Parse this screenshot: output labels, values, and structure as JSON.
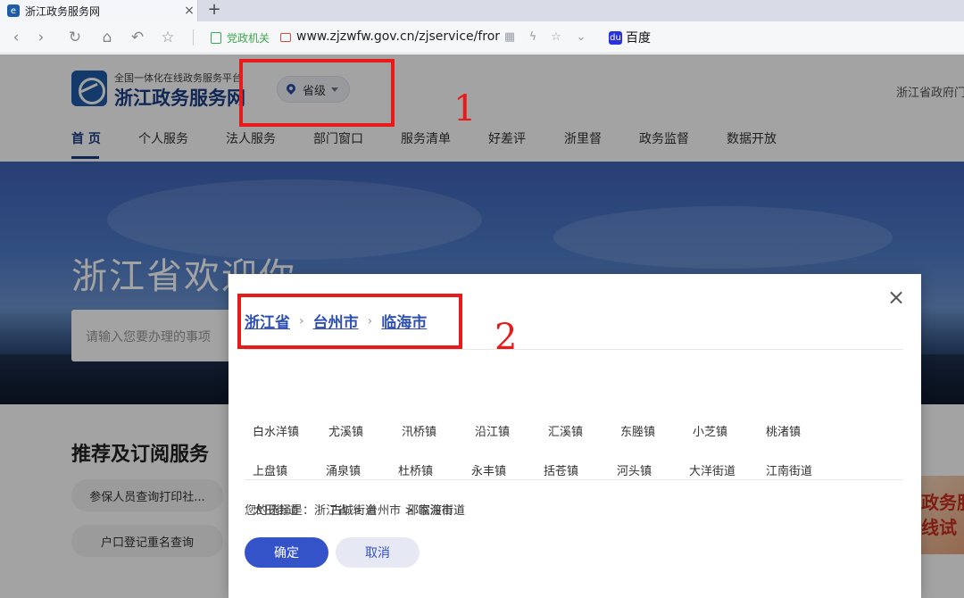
{
  "browser": {
    "tab_title": "浙江政务服务网",
    "tab_close": "×",
    "new_tab": "+",
    "security_label": "党政机关",
    "url": "www.zjzwfw.gov.cn/zjservice/fror",
    "search_engine": "百度",
    "icons": [
      "back-icon",
      "forward-icon",
      "refresh-icon",
      "home-icon",
      "undo-icon",
      "favorite-icon",
      "qr-icon",
      "bolt-icon",
      "star-icon",
      "dropdown-icon"
    ]
  },
  "header": {
    "logo_small": "全国一体化在线政务服务平台",
    "logo_big": "浙江政务服务网",
    "region": "省级",
    "right_text": "浙江省政府门"
  },
  "annotations": {
    "one": "1",
    "two": "2",
    "color": "#e81a1a"
  },
  "nav": {
    "items": [
      "首 页",
      "个人服务",
      "法人服务",
      "部门窗口",
      "服务清单",
      "好差评",
      "浙里督",
      "政务监督",
      "数据开放"
    ]
  },
  "hero": {
    "title": "浙江省欢迎你",
    "search_placeholder": "请输入您要办理的事项"
  },
  "section": {
    "title": "推荐及订阅服务",
    "services": [
      "参保人员查询打印社...",
      "户口登记重名查询"
    ]
  },
  "side_banner": {
    "line1": "政务服",
    "line2": "线试"
  },
  "modal": {
    "close": "×",
    "breadcrumb": [
      "浙江省",
      "台州市",
      "临海市"
    ],
    "separator": "›",
    "towns": [
      [
        "白水洋镇",
        "尤溪镇",
        "汛桥镇",
        "沿江镇",
        "汇溪镇",
        "东塍镇",
        "小芝镇",
        "桃渚镇"
      ],
      [
        "上盘镇",
        "涌泉镇",
        "杜桥镇",
        "永丰镇",
        "括苍镇",
        "河头镇",
        "大洋街道",
        "江南街道"
      ],
      [
        "大田街道",
        "古城街道",
        "邵家渡街道"
      ]
    ],
    "selection_text": "您的选择是：浙江省 > 台州市 > 临海市",
    "confirm": "确定",
    "cancel": "取消"
  },
  "colors": {
    "brand": "#1a3e86",
    "primary_button": "#3553c8",
    "link": "#2f4fb5"
  }
}
